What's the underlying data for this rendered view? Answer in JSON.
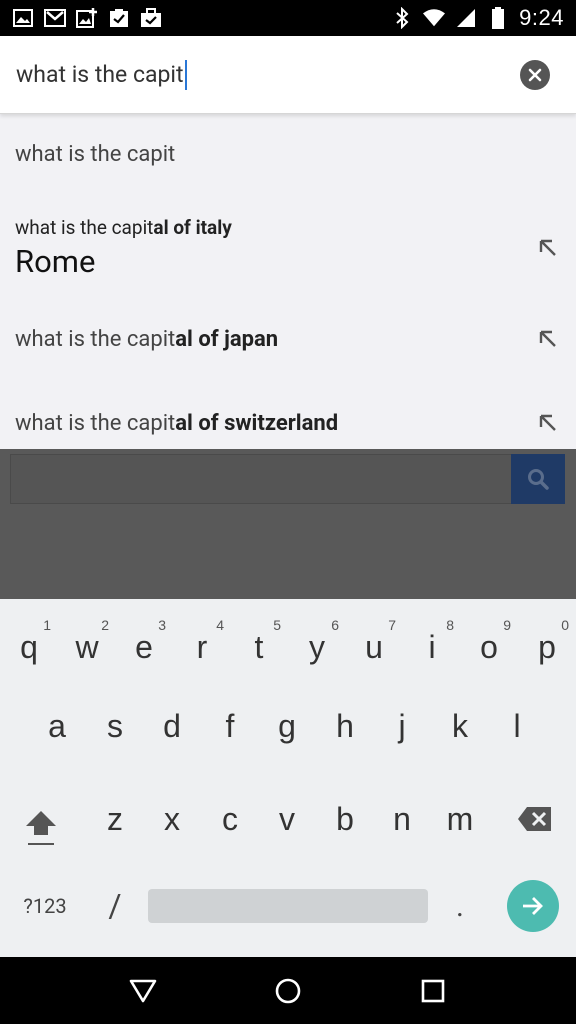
{
  "status_bar": {
    "time": "9:24",
    "left_icons": [
      "gallery-icon",
      "gmail-icon",
      "photos-add-icon",
      "task-check-icon",
      "briefcase-check-icon"
    ],
    "right_icons": [
      "bluetooth-icon",
      "wifi-icon",
      "cell-signal-icon",
      "battery-icon"
    ]
  },
  "search": {
    "query": "what is the capit",
    "clear_icon": "close-icon"
  },
  "suggestions": [
    {
      "prefix": "what is the capit",
      "suffix": ""
    },
    {
      "prefix": "what is the capit",
      "suffix": "al of italy",
      "answer": "Rome"
    },
    {
      "prefix": "what is the capit",
      "suffix": "al of japan"
    },
    {
      "prefix": "what is the capit",
      "suffix": "al of switzerland"
    }
  ],
  "keyboard": {
    "row1": [
      {
        "key": "q",
        "hint": "1"
      },
      {
        "key": "w",
        "hint": "2"
      },
      {
        "key": "e",
        "hint": "3"
      },
      {
        "key": "r",
        "hint": "4"
      },
      {
        "key": "t",
        "hint": "5"
      },
      {
        "key": "y",
        "hint": "6"
      },
      {
        "key": "u",
        "hint": "7"
      },
      {
        "key": "i",
        "hint": "8"
      },
      {
        "key": "o",
        "hint": "9"
      },
      {
        "key": "p",
        "hint": "0"
      }
    ],
    "row2": [
      "a",
      "s",
      "d",
      "f",
      "g",
      "h",
      "j",
      "k",
      "l"
    ],
    "row3": [
      "z",
      "x",
      "c",
      "v",
      "b",
      "n",
      "m"
    ],
    "symbols_label": "?123",
    "slash_label": "/",
    "period_label": "."
  },
  "colors": {
    "go_button": "#4dbbb0",
    "caret": "#2a77d6",
    "page_search_button": "#1f3a66"
  }
}
